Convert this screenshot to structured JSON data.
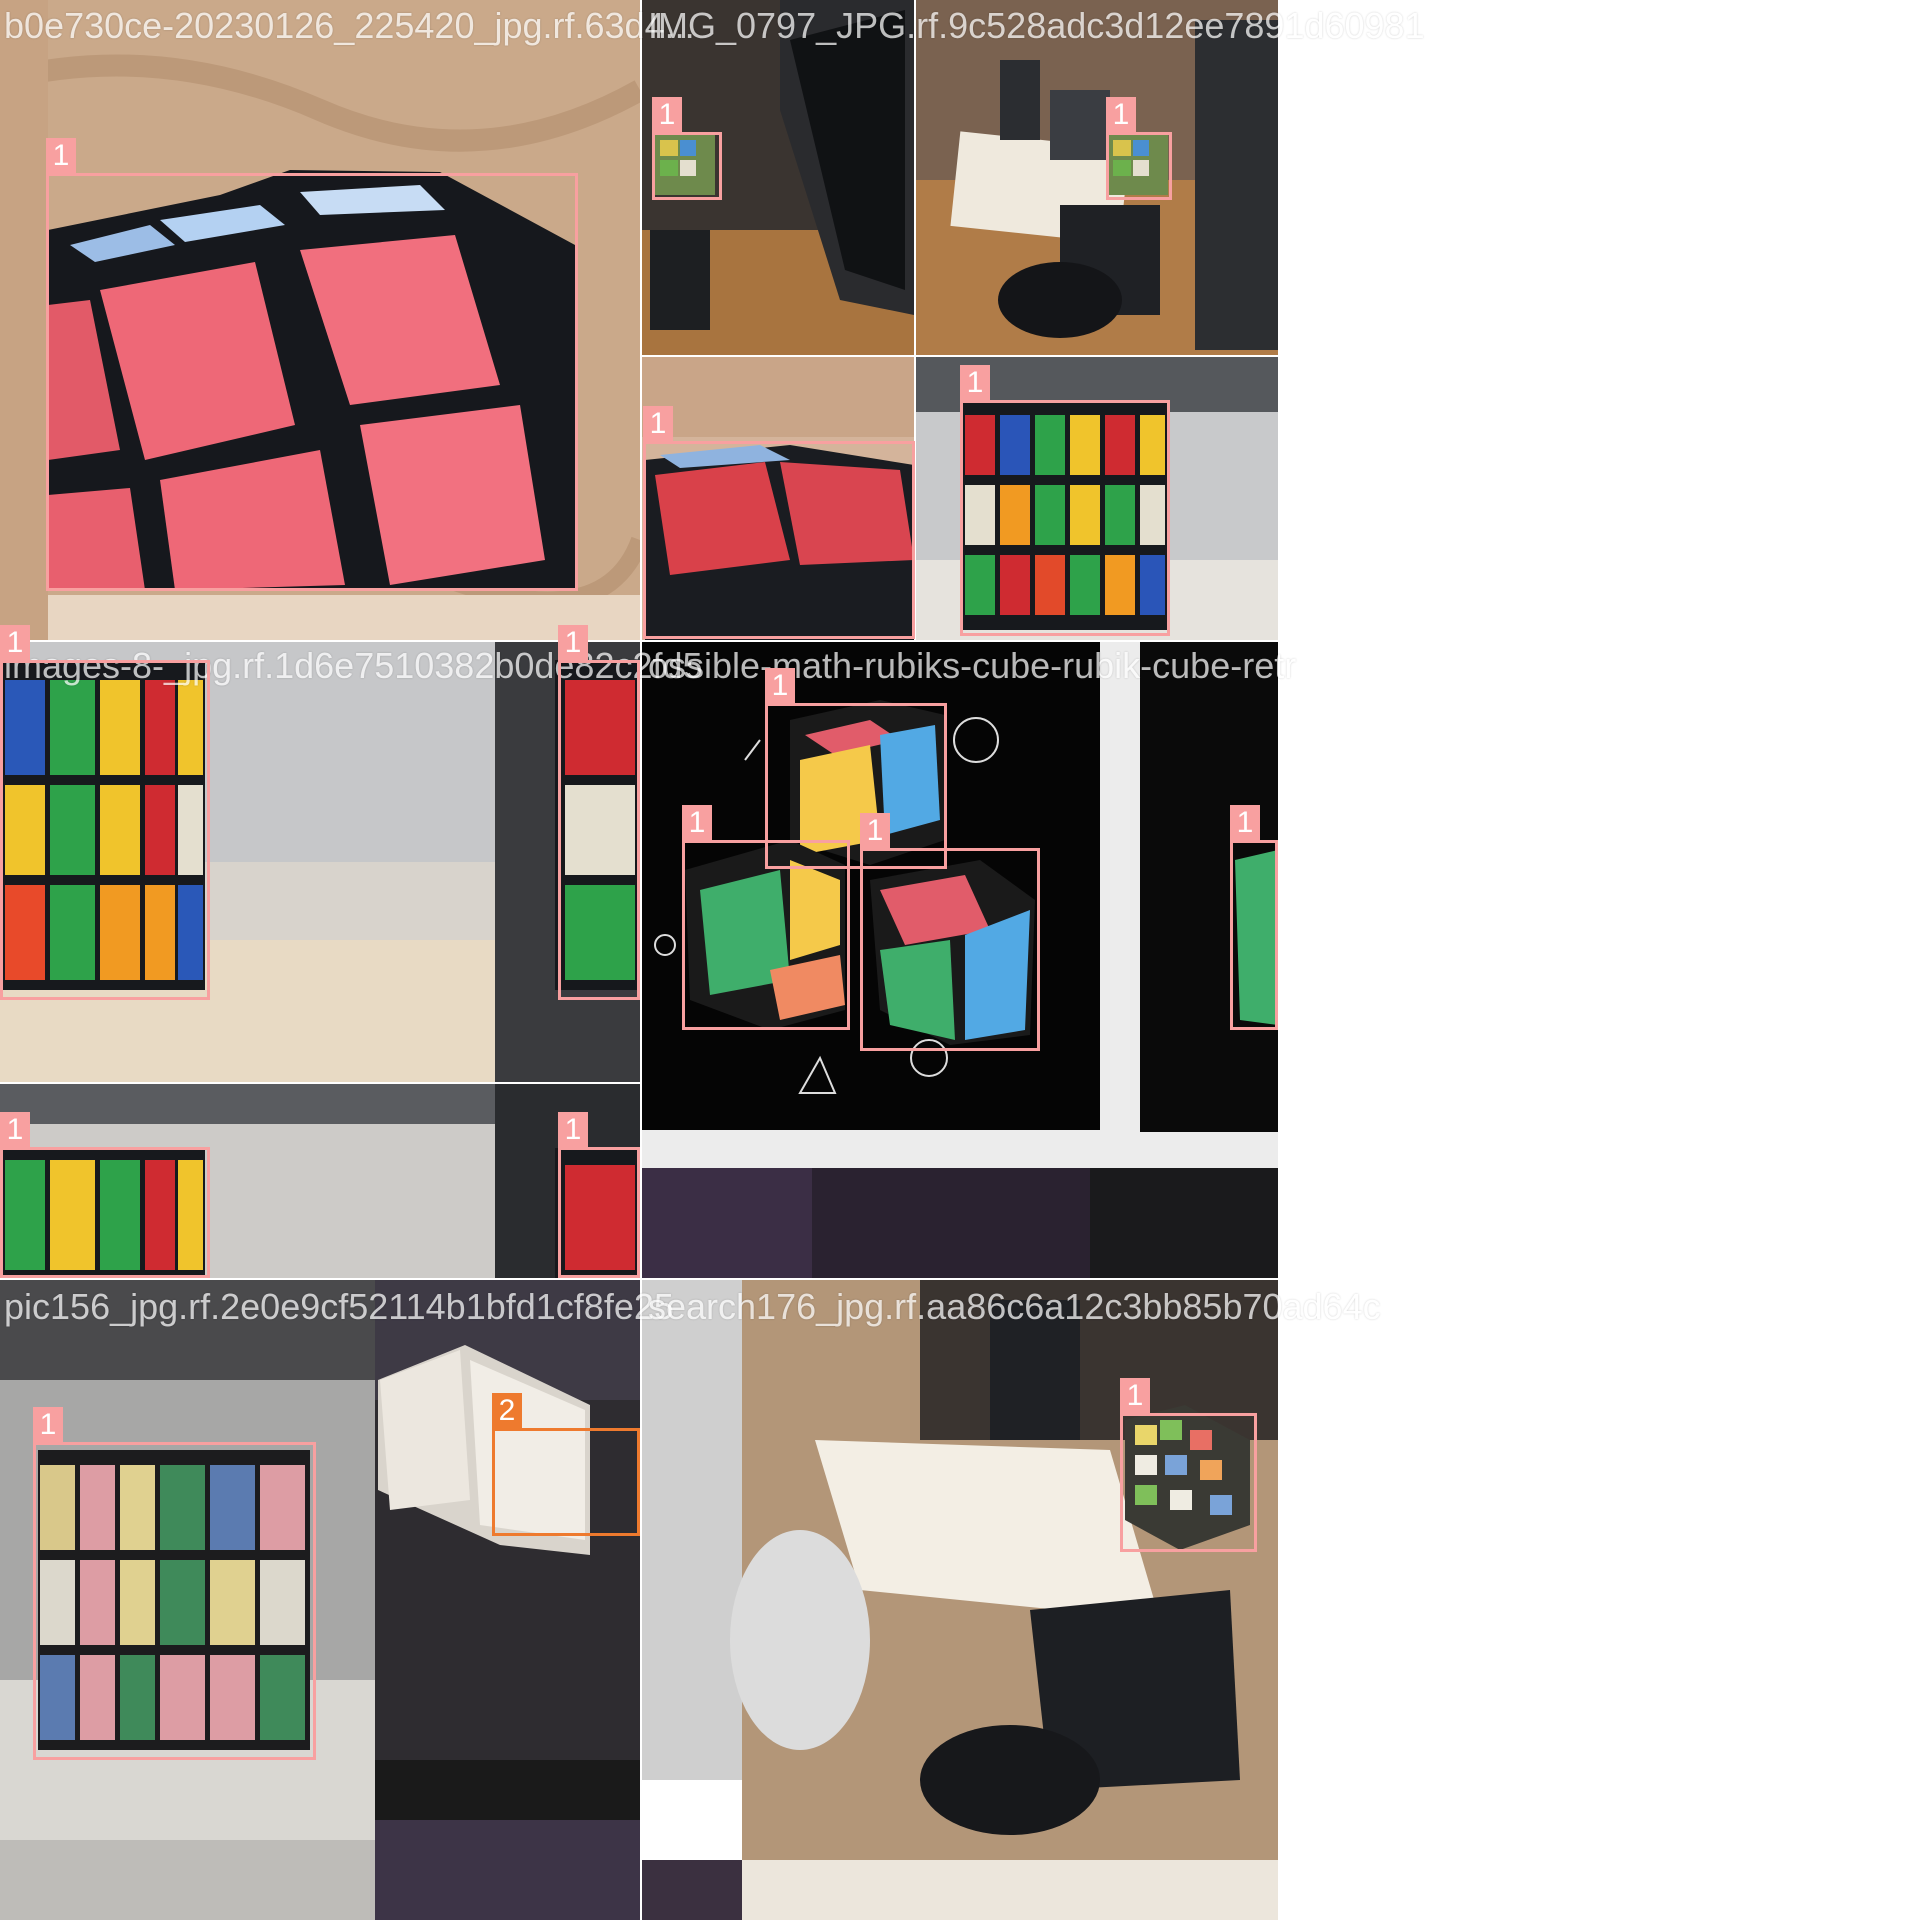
{
  "classes": {
    "1": {
      "color": "#f8a0a0"
    },
    "2": {
      "color": "#ee7a2e"
    }
  },
  "tiles": [
    {
      "title": "b0e730ce-20230126_225420_jpg.rf.63d4...",
      "labels": [
        "1"
      ]
    },
    {
      "title": "IMG_0797_JPG.rf.9c528adc3d12ee7891d60981",
      "labels": [
        "1",
        "1",
        "1",
        "1"
      ]
    },
    {
      "title": "images-8-_jpg.rf.1d6e7510382b0de82c2fd5",
      "labels": [
        "1",
        "1",
        "1",
        "1"
      ]
    },
    {
      "title": "ossible-math-rubiks-cube-rubik-cube-retr",
      "labels": [
        "1",
        "1",
        "1",
        "1"
      ]
    },
    {
      "title": "pic156_jpg.rf.2e0e9cf52114b1bfd1cf8fe25",
      "labels": [
        "1",
        "2"
      ]
    },
    {
      "title": "search176_jpg.rf.aa86c6a12c3bb85b70ad64c",
      "labels": [
        "1"
      ]
    }
  ]
}
